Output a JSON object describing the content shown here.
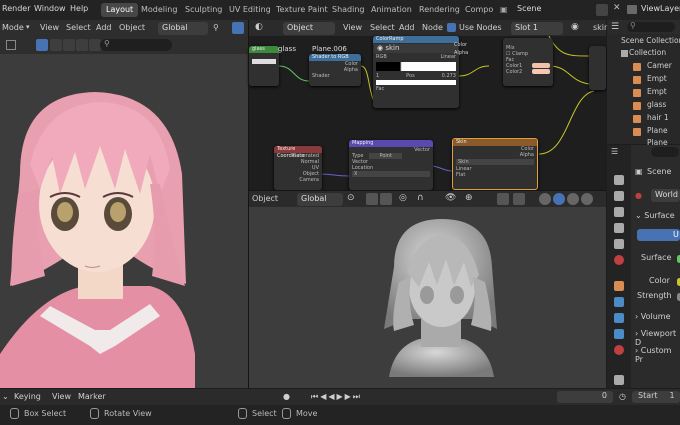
{
  "menu": {
    "render": "Render",
    "window": "Window",
    "help": "Help"
  },
  "workspaces": [
    {
      "label": "Layout",
      "active": true
    },
    {
      "label": "Modeling",
      "active": false
    },
    {
      "label": "Sculpting",
      "active": false
    },
    {
      "label": "UV Editing",
      "active": false
    },
    {
      "label": "Texture Paint",
      "active": false
    },
    {
      "label": "Shading",
      "active": false
    },
    {
      "label": "Animation",
      "active": false
    },
    {
      "label": "Rendering",
      "active": false
    },
    {
      "label": "Compo",
      "active": false
    }
  ],
  "scene_name": "Scene",
  "view_layer": "ViewLayer",
  "left_header": {
    "mode": "Mode",
    "view": "View",
    "select": "Select",
    "add": "Add",
    "object": "Object",
    "orientation": "Global"
  },
  "node_header": {
    "type": "Object",
    "view": "View",
    "select": "Select",
    "add": "Add",
    "node": "Node",
    "use_nodes": "Use Nodes",
    "slot": "Slot 1",
    "material": "skin"
  },
  "nodes": {
    "glass": "glass",
    "plane": "Plane.006",
    "mix_shader_title": "Shader to RGB",
    "mix_shader_fields": {
      "shader": "Shader",
      "color": "Color",
      "alpha": "Alpha"
    },
    "ramp_title": "ColorRamp",
    "ramp_material": "skin",
    "ramp_fields": {
      "mode": "RGB",
      "interp": "Linear",
      "index": "1",
      "pos_label": "Pos",
      "pos": "0.273",
      "fac": "Fac",
      "color": "Color",
      "alpha": "Alpha"
    },
    "mixrgb_fields": {
      "blend": "Mix",
      "clamp": "Clamp",
      "fac": "Fac",
      "color1": "Color1",
      "color2": "Color2"
    },
    "texcoord_title": "Texture Coordinate",
    "texcoord_fields": [
      "Generated",
      "Normal",
      "UV",
      "Object",
      "Camera"
    ],
    "mapping_title": "Mapping",
    "mapping_fields": {
      "vector": "Vector",
      "type_label": "Type",
      "type": "Point",
      "vector_in": "Vector",
      "location": "Location",
      "x": "X"
    },
    "image_title": "Skin",
    "image_fields": {
      "color": "Color",
      "alpha": "Alpha",
      "name": "Skin",
      "interp": "Linear",
      "proj": "Flat"
    },
    "emission_fields": {
      "color": "Color",
      "strength": "Strength"
    }
  },
  "viewport2_header": {
    "object": "Object",
    "orientation": "Global"
  },
  "outliner": {
    "title": "Scene Collection",
    "items": [
      {
        "label": "Collection"
      },
      {
        "label": "Camer"
      },
      {
        "label": "Empt"
      },
      {
        "label": "Empt"
      },
      {
        "label": "glass"
      },
      {
        "label": "hair 1"
      },
      {
        "label": "Plane"
      },
      {
        "label": "Plane"
      }
    ]
  },
  "properties": {
    "scene": "Scene",
    "world": "World",
    "surface_panel": "Surface",
    "use_label": "U",
    "surface_label": "Surface",
    "color_label": "Color",
    "strength_label": "Strength",
    "volume_panel": "Volume",
    "viewport_panel": "Viewport D",
    "custom_panel": "Custom Pr"
  },
  "timeline": {
    "keying": "Keying",
    "view": "View",
    "marker": "Marker",
    "frame": "0",
    "start_label": "Start",
    "start": "1"
  },
  "statusbar": {
    "box_select": "Box Select",
    "rotate_view": "Rotate View",
    "select": "Select",
    "move": "Move"
  },
  "colors": {
    "accent": "#4772b3",
    "header": "#2b2b2b",
    "viewport": "#3d3d3d",
    "node_bg": "#1d1d1d",
    "hair": "#e9a3b2"
  }
}
